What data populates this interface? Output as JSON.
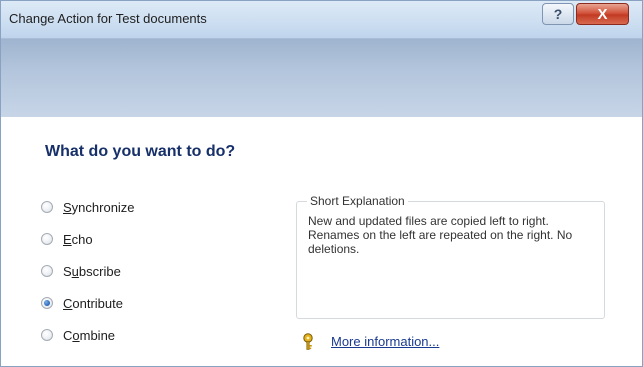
{
  "window": {
    "title": "Change Action for Test documents",
    "help_glyph": "?",
    "close_glyph": "X"
  },
  "heading": "What do you want to do?",
  "options": [
    {
      "label": "Synchronize",
      "mnemonic": "S",
      "selected": false
    },
    {
      "label": "Echo",
      "mnemonic": "E",
      "selected": false
    },
    {
      "label": "Subscribe",
      "mnemonic": "u",
      "selected": false
    },
    {
      "label": "Contribute",
      "mnemonic": "C",
      "selected": true
    },
    {
      "label": "Combine",
      "mnemonic": "o",
      "selected": false
    }
  ],
  "explanation": {
    "title": "Short Explanation",
    "text": "New and updated files are copied left to right. Renames on the left are repeated on the right. No deletions."
  },
  "more_info": {
    "label": "More information...",
    "icon": "key-help-icon"
  },
  "colors": {
    "heading": "#17306a",
    "link": "#1a3a8f",
    "banner": "#b3c5dc",
    "close_button": "#c23a24"
  }
}
